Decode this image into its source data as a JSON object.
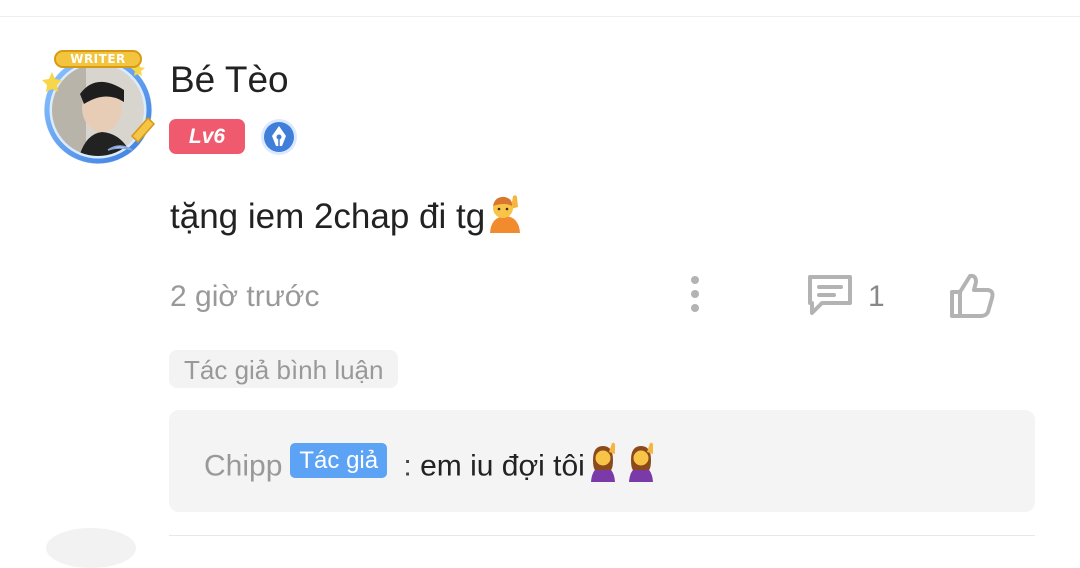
{
  "comment": {
    "user": {
      "name": "Bé Tèo",
      "avatar_badge": "WRITER",
      "level": "Lv6",
      "badge_icon": "pen-nib-icon"
    },
    "text": "tặng iem 2chap đi tg",
    "emoji": "🙋",
    "time": "2 giờ trước",
    "actions": {
      "more_icon": "more-vertical-icon",
      "reply_icon": "comment-icon",
      "reply_count": "1",
      "like_icon": "thumbs-up-icon"
    },
    "author_reply_label": "Tác giả bình luận",
    "reply": {
      "author": "Chipp",
      "author_tag": "Tác giả",
      "separator": " : ",
      "text": "em iu đợi tôi",
      "emojis": "🙋🙋"
    }
  },
  "colors": {
    "level_badge": "#ef5a6f",
    "author_tag": "#5ca3f5",
    "pen_badge": "#3f7fd9",
    "muted_text": "#999999"
  }
}
